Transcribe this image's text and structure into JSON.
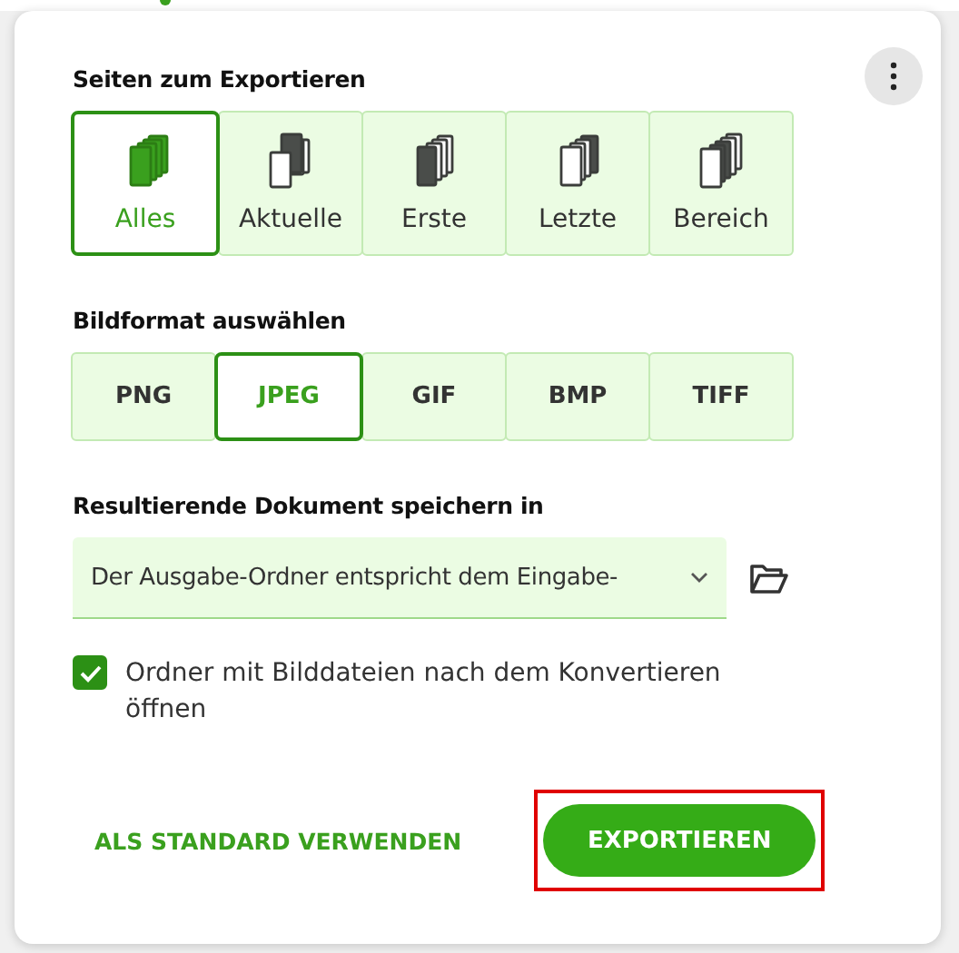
{
  "pages": {
    "title": "Seiten zum Exportieren",
    "options": [
      {
        "label": "Alles",
        "kind": "all",
        "selected": true
      },
      {
        "label": "Aktuelle",
        "kind": "current",
        "selected": false
      },
      {
        "label": "Erste",
        "kind": "first",
        "selected": false
      },
      {
        "label": "Letzte",
        "kind": "last",
        "selected": false
      },
      {
        "label": "Bereich",
        "kind": "range",
        "selected": false
      }
    ]
  },
  "format": {
    "title": "Bildformat auswählen",
    "options": [
      {
        "label": "PNG",
        "selected": false
      },
      {
        "label": "JPEG",
        "selected": true
      },
      {
        "label": "GIF",
        "selected": false
      },
      {
        "label": "BMP",
        "selected": false
      },
      {
        "label": "TIFF",
        "selected": false
      }
    ]
  },
  "output": {
    "title": "Resultierende Dokument speichern in",
    "value": "Der Ausgabe-Ordner entspricht dem Eingabe-"
  },
  "open_folder": {
    "label": "Ordner mit Bilddateien nach dem Konvertieren öffnen",
    "checked": true
  },
  "buttons": {
    "default": "ALS STANDARD VERWENDEN",
    "export": "EXPORTIEREN",
    "export_highlighted": true
  }
}
